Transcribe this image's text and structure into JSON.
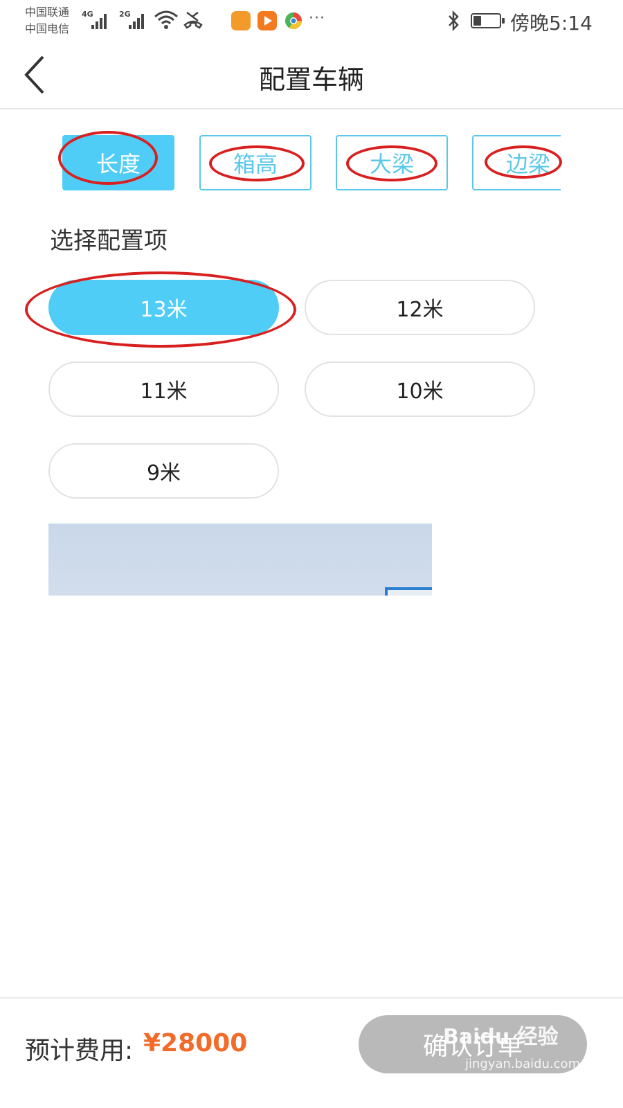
{
  "status_bar": {
    "carrier_1": "中国联通",
    "carrier_2": "中国电信",
    "network_1": "4G",
    "network_2": "2G",
    "more": "···",
    "time": "傍晚5:14",
    "battery_level": 0.3,
    "icons": [
      "signal-icon",
      "wifi-icon",
      "call-mute-icon",
      "uc-browser-icon",
      "video-app-icon",
      "chrome-like-icon",
      "bluetooth-icon",
      "battery-icon"
    ]
  },
  "navbar": {
    "title": "配置车辆",
    "back_icon": "chevron-left-icon"
  },
  "tabs": [
    {
      "label": "长度",
      "active": true
    },
    {
      "label": "箱高",
      "active": false
    },
    {
      "label": "大梁",
      "active": false
    },
    {
      "label": "边梁",
      "active": false
    }
  ],
  "section_title": "选择配置项",
  "options": [
    {
      "label": "13米",
      "selected": true
    },
    {
      "label": "12米",
      "selected": false
    },
    {
      "label": "11米",
      "selected": false
    },
    {
      "label": "10米",
      "selected": false
    },
    {
      "label": "9米",
      "selected": false
    }
  ],
  "footer": {
    "price_label": "预计费用:",
    "price_value": "¥28000",
    "confirm_label": "确认订单"
  },
  "watermark": {
    "brand": "Baidu 经验",
    "url": "jingyan.baidu.com"
  },
  "colors": {
    "accent": "#4fcdf6",
    "price": "#f26b2a",
    "annotation": "#d82020",
    "disabled_button": "#b9b9b9"
  }
}
